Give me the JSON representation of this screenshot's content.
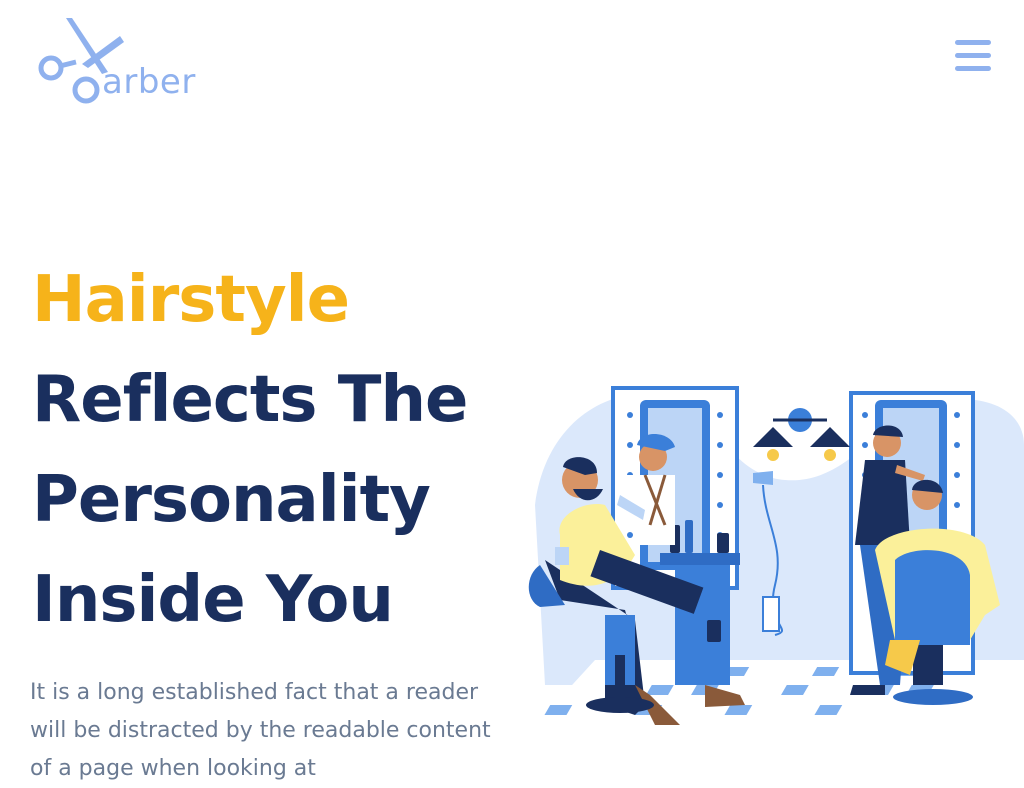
{
  "header": {
    "logo_text": "arber",
    "logo_icon": "scissors-icon",
    "menu_icon": "hamburger-menu-icon"
  },
  "hero": {
    "title_highlight": "Hairstyle",
    "title_lines": [
      "Reflects The",
      "Personality",
      "Inside You"
    ],
    "description": "It is a long established fact that a reader will be distracted by the readable content of a page when looking at"
  },
  "illustration": {
    "subject": "barber-shop-illustration"
  },
  "colors": {
    "accent": "#f6b31a",
    "heading": "#1a2f5e",
    "body_text": "#6a7a92",
    "logo": "#8fb1ee",
    "illustration_blue": "#3b7fd9"
  }
}
